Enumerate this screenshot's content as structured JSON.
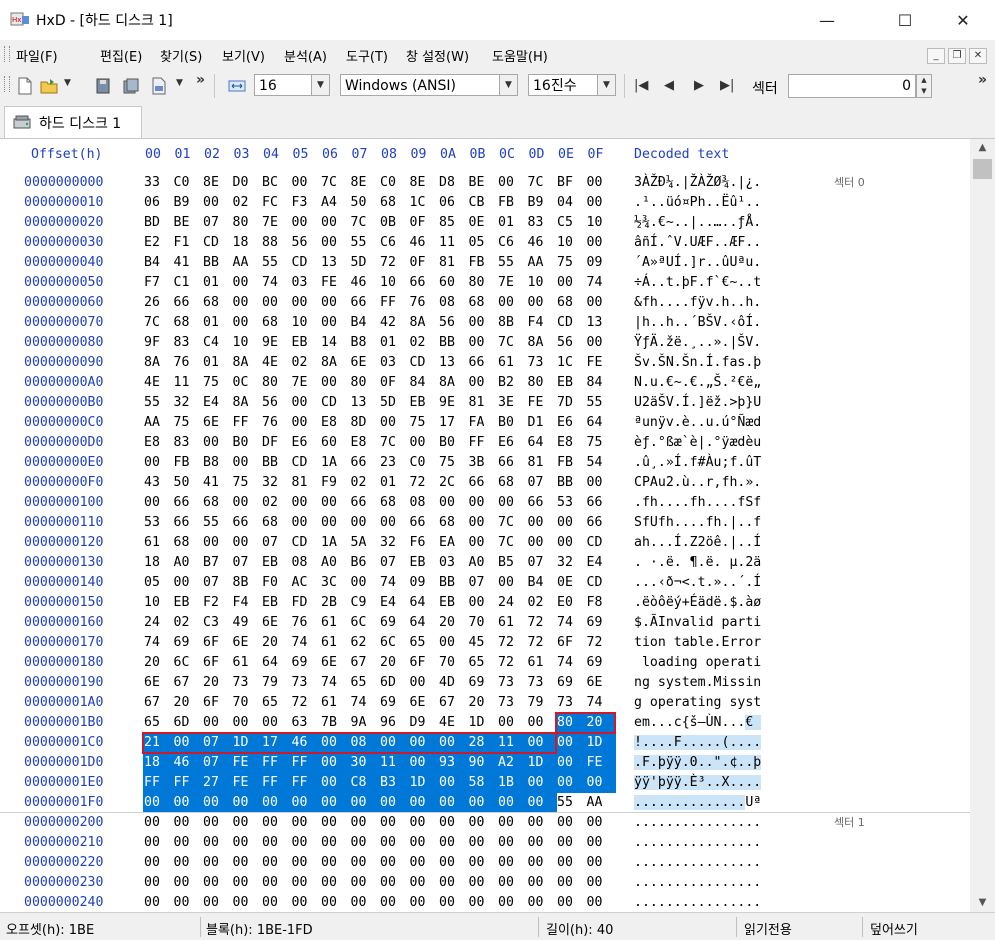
{
  "window": {
    "title": "HxD - [하드 디스크 1]",
    "minimize": "—",
    "maximize": "☐",
    "close": "✕"
  },
  "menu": [
    "파일(F)",
    "편집(E)",
    "찾기(S)",
    "보기(V)",
    "분석(A)",
    "도구(T)",
    "창 설정(W)",
    "도움말(H)"
  ],
  "toolbar": {
    "bytes_per_row": "16",
    "encoding": "Windows (ANSI)",
    "offset_base": "16진수",
    "sector_label": "섹터",
    "sector_value": "0",
    "overflow": "»"
  },
  "tab": {
    "label": "하드 디스크 1"
  },
  "header": {
    "offset": "Offset(h)",
    "columns": [
      "00",
      "01",
      "02",
      "03",
      "04",
      "05",
      "06",
      "07",
      "08",
      "09",
      "0A",
      "0B",
      "0C",
      "0D",
      "0E",
      "0F"
    ],
    "decoded": "Decoded text"
  },
  "sector_tags": [
    {
      "label": "섹터 0",
      "row": 0
    },
    {
      "label": "섹터 1",
      "row": 32
    }
  ],
  "rows": [
    {
      "offset": "0000000000",
      "hex": "33 C0 8E D0 BC 00 7C 8E C0 8E D8 BE 00 7C BF 00",
      "text": "3ÀŽÐ¼.|ŽÀŽØ¾.|¿."
    },
    {
      "offset": "0000000010",
      "hex": "06 B9 00 02 FC F3 A4 50 68 1C 06 CB FB B9 04 00",
      "text": ".¹..üó¤Ph..Ëû¹.."
    },
    {
      "offset": "0000000020",
      "hex": "BD BE 07 80 7E 00 00 7C 0B 0F 85 0E 01 83 C5 10",
      "text": "½¾.€~..|..…..ƒÅ."
    },
    {
      "offset": "0000000030",
      "hex": "E2 F1 CD 18 88 56 00 55 C6 46 11 05 C6 46 10 00",
      "text": "âñÍ.ˆV.UÆF..ÆF.."
    },
    {
      "offset": "0000000040",
      "hex": "B4 41 BB AA 55 CD 13 5D 72 0F 81 FB 55 AA 75 09",
      "text": "´A»ªUÍ.]r..ûUªu."
    },
    {
      "offset": "0000000050",
      "hex": "F7 C1 01 00 74 03 FE 46 10 66 60 80 7E 10 00 74",
      "text": "÷Á..t.þF.f`€~..t"
    },
    {
      "offset": "0000000060",
      "hex": "26 66 68 00 00 00 00 66 FF 76 08 68 00 00 68 00",
      "text": "&fh....fÿv.h..h."
    },
    {
      "offset": "0000000070",
      "hex": "7C 68 01 00 68 10 00 B4 42 8A 56 00 8B F4 CD 13",
      "text": "|h..h..´BŠV.‹ôÍ."
    },
    {
      "offset": "0000000080",
      "hex": "9F 83 C4 10 9E EB 14 B8 01 02 BB 00 7C 8A 56 00",
      "text": "ŸƒÄ.žë.¸..».|ŠV."
    },
    {
      "offset": "0000000090",
      "hex": "8A 76 01 8A 4E 02 8A 6E 03 CD 13 66 61 73 1C FE",
      "text": "Šv.ŠN.Šn.Í.fas.þ"
    },
    {
      "offset": "00000000A0",
      "hex": "4E 11 75 0C 80 7E 00 80 0F 84 8A 00 B2 80 EB 84",
      "text": "N.u.€~.€.„Š.²€ë„"
    },
    {
      "offset": "00000000B0",
      "hex": "55 32 E4 8A 56 00 CD 13 5D EB 9E 81 3E FE 7D 55",
      "text": "U2äŠV.Í.]ëž.>þ}U"
    },
    {
      "offset": "00000000C0",
      "hex": "AA 75 6E FF 76 00 E8 8D 00 75 17 FA B0 D1 E6 64",
      "text": "ªunÿv.è..u.ú°Ñæd"
    },
    {
      "offset": "00000000D0",
      "hex": "E8 83 00 B0 DF E6 60 E8 7C 00 B0 FF E6 64 E8 75",
      "text": "èƒ.°ßæ`è|.°ÿædèu"
    },
    {
      "offset": "00000000E0",
      "hex": "00 FB B8 00 BB CD 1A 66 23 C0 75 3B 66 81 FB 54",
      "text": ".û¸.»Í.f#Àu;f.ûT"
    },
    {
      "offset": "00000000F0",
      "hex": "43 50 41 75 32 81 F9 02 01 72 2C 66 68 07 BB 00",
      "text": "CPAu2.ù..r,fh.»."
    },
    {
      "offset": "0000000100",
      "hex": "00 66 68 00 02 00 00 66 68 08 00 00 00 66 53 66",
      "text": ".fh....fh....fSf"
    },
    {
      "offset": "0000000110",
      "hex": "53 66 55 66 68 00 00 00 00 66 68 00 7C 00 00 66",
      "text": "SfUfh....fh.|..f"
    },
    {
      "offset": "0000000120",
      "hex": "61 68 00 00 07 CD 1A 5A 32 F6 EA 00 7C 00 00 CD",
      "text": "ah...Í.Z2öê.|..Í"
    },
    {
      "offset": "0000000130",
      "hex": "18 A0 B7 07 EB 08 A0 B6 07 EB 03 A0 B5 07 32 E4",
      "text": ". ·.ë. ¶.ë. µ.2ä"
    },
    {
      "offset": "0000000140",
      "hex": "05 00 07 8B F0 AC 3C 00 74 09 BB 07 00 B4 0E CD",
      "text": "...‹ð¬<.t.»..´.Í"
    },
    {
      "offset": "0000000150",
      "hex": "10 EB F2 F4 EB FD 2B C9 E4 64 EB 00 24 02 E0 F8",
      "text": ".ëòôëý+Éädë.$.àø"
    },
    {
      "offset": "0000000160",
      "hex": "24 02 C3 49 6E 76 61 6C 69 64 20 70 61 72 74 69",
      "text": "$.ÃInvalid parti"
    },
    {
      "offset": "0000000170",
      "hex": "74 69 6F 6E 20 74 61 62 6C 65 00 45 72 72 6F 72",
      "text": "tion table.Error"
    },
    {
      "offset": "0000000180",
      "hex": "20 6C 6F 61 64 69 6E 67 20 6F 70 65 72 61 74 69",
      "text": " loading operati"
    },
    {
      "offset": "0000000190",
      "hex": "6E 67 20 73 79 73 74 65 6D 00 4D 69 73 73 69 6E",
      "text": "ng system.Missin"
    },
    {
      "offset": "00000001A0",
      "hex": "67 20 6F 70 65 72 61 74 69 6E 67 20 73 79 73 74",
      "text": "g operating syst"
    },
    {
      "offset": "00000001B0",
      "hex": "65 6D 00 00 00 63 7B 9A 96 D9 4E 1D 00 00 80 20",
      "text": "em...c{š–ÙN...€ "
    },
    {
      "offset": "00000001C0",
      "hex": "21 00 07 1D 17 46 00 08 00 00 00 28 11 00 00 1D",
      "text": "!....F.....(...."
    },
    {
      "offset": "00000001D0",
      "hex": "18 46 07 FE FF FF 00 30 11 00 93 90 A2 1D 00 FE",
      "text": ".F.þÿÿ.0..\".¢..þ"
    },
    {
      "offset": "00000001E0",
      "hex": "FF FF 27 FE FF FF 00 C8 B3 1D 00 58 1B 00 00 00",
      "text": "ÿÿ'þÿÿ.È³..X...."
    },
    {
      "offset": "00000001F0",
      "hex": "00 00 00 00 00 00 00 00 00 00 00 00 00 00 55 AA",
      "text": "..............Uª"
    },
    {
      "offset": "0000000200",
      "hex": "00 00 00 00 00 00 00 00 00 00 00 00 00 00 00 00",
      "text": "................"
    },
    {
      "offset": "0000000210",
      "hex": "00 00 00 00 00 00 00 00 00 00 00 00 00 00 00 00",
      "text": "................"
    },
    {
      "offset": "0000000220",
      "hex": "00 00 00 00 00 00 00 00 00 00 00 00 00 00 00 00",
      "text": "................"
    },
    {
      "offset": "0000000230",
      "hex": "00 00 00 00 00 00 00 00 00 00 00 00 00 00 00 00",
      "text": "................"
    },
    {
      "offset": "0000000240",
      "hex": "00 00 00 00 00 00 00 00 00 00 00 00 00 00 00 00",
      "text": "................"
    }
  ],
  "selection": {
    "start": 446,
    "end": 509
  },
  "status": {
    "offset": "오프셋(h): 1BE",
    "block": "블록(h): 1BE-1FD",
    "length": "길이(h): 40",
    "mode": "읽기전용",
    "insert": "덮어쓰기"
  },
  "colors": {
    "offset_blue": "#2040c0",
    "selection": "#0078d7",
    "selection_text_bg": "#cce4f7",
    "highlight_box": "#d01828"
  }
}
